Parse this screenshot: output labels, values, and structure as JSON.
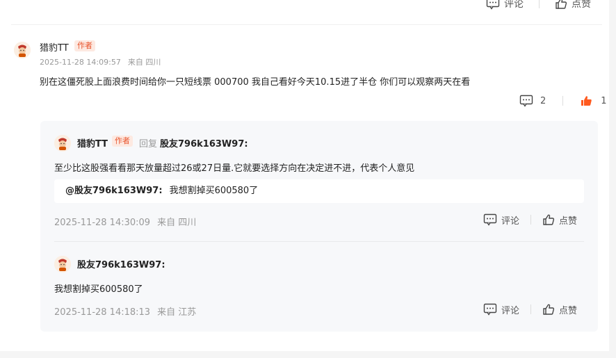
{
  "top_actions": {
    "comment_label": "评论",
    "like_label": "点赞"
  },
  "main_comment": {
    "username": "猎豹TT",
    "badge": "作者",
    "time": "2025-11-28 14:09:57",
    "location": "来自 四川",
    "text": "别在这僵死股上面浪费时间给你一只短线票 000700 我自己看好今天10.15进了半仓 你们可以观察两天在看",
    "comment_count": "2",
    "like_count": "1"
  },
  "replies": [
    {
      "username": "猎豹TT",
      "badge": "作者",
      "reply_word": "回复",
      "reply_to": "股友796k163W97:",
      "text": "至少比这股强看看那天放量超过26或27日量.它就要选择方向在决定进不进，代表个人意见",
      "quote_user": "@股友796k163W97:",
      "quote_text": "我想割掉买600580了",
      "time": "2025-11-28 14:30:09",
      "location": "来自 四川",
      "comment_label": "评论",
      "like_label": "点赞"
    },
    {
      "username": "股友796k163W97:",
      "text": "我想割掉买600580了",
      "time": "2025-11-28 14:18:13",
      "location": "来自 江苏",
      "comment_label": "评论",
      "like_label": "点赞"
    }
  ],
  "colors": {
    "accent": "#e8552d",
    "like_active": "#ff5a1f",
    "muted": "#999999"
  }
}
